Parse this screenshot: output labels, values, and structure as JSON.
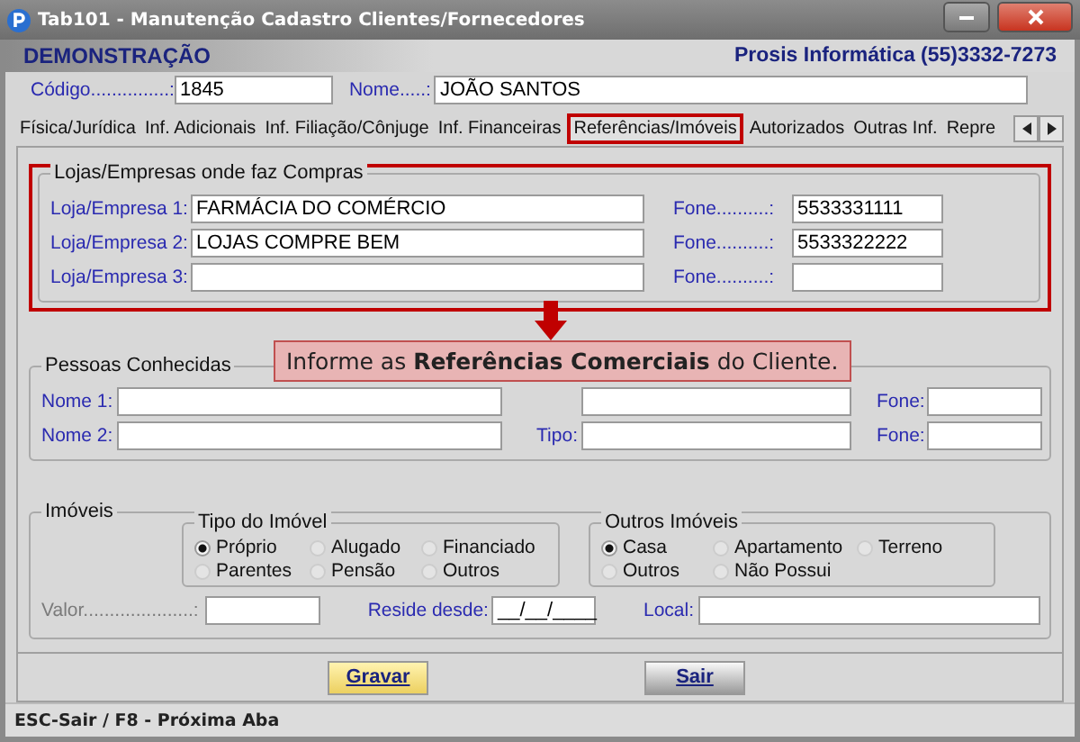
{
  "window": {
    "title": "Tab101 - Manutenção Cadastro Clientes/Fornecedores"
  },
  "header": {
    "company": "DEMONSTRAÇÃO",
    "vendor": "Prosis Informática (55)3332-7273"
  },
  "client": {
    "code_label": "Código...............:",
    "code": "1845",
    "name_label": "Nome.....:",
    "name": "JOÃO SANTOS"
  },
  "tabs": [
    {
      "label": "Física/Jurídica",
      "selected": false
    },
    {
      "label": "Inf. Adicionais",
      "selected": false
    },
    {
      "label": "Inf. Filiação/Cônjuge",
      "selected": false
    },
    {
      "label": "Inf. Financeiras",
      "selected": false
    },
    {
      "label": "Referências/Imóveis",
      "selected": true
    },
    {
      "label": "Autorizados",
      "selected": false
    },
    {
      "label": "Outras Inf.",
      "selected": false
    },
    {
      "label": "Repre",
      "selected": false
    }
  ],
  "stores": {
    "title": "Lojas/Empresas onde faz Compras",
    "rows": [
      {
        "label": "Loja/Empresa 1:",
        "value": "FARMÁCIA DO COMÉRCIO",
        "phone_label": "Fone..........:",
        "phone": "5533331111"
      },
      {
        "label": "Loja/Empresa 2:",
        "value": "LOJAS COMPRE BEM",
        "phone_label": "Fone..........:",
        "phone": "5533322222"
      },
      {
        "label": "Loja/Empresa 3:",
        "phone_label": "Fone..........:"
      }
    ]
  },
  "tooltip": {
    "text": "Informe as **Referências Comerciais** do Cliente."
  },
  "people": {
    "title": "Pessoas Conhecidas",
    "rows": [
      {
        "label": "Nome 1:",
        "phone_label": "Fone:"
      },
      {
        "label": "Nome 2:",
        "type_label": "Tipo:",
        "phone_label": "Fone:"
      }
    ]
  },
  "property": {
    "title": "Imóveis",
    "type_group": {
      "title": "Tipo do Imóvel",
      "options": [
        {
          "label": "Próprio",
          "selected": true
        },
        {
          "label": "Alugado",
          "selected": false
        },
        {
          "label": "Financiado",
          "selected": false
        },
        {
          "label": "Parentes",
          "selected": false
        },
        {
          "label": "Pensão",
          "selected": false
        },
        {
          "label": "Outros",
          "selected": false
        }
      ]
    },
    "other_group": {
      "title": "Outros Imóveis",
      "options": [
        {
          "label": "Casa",
          "selected": true
        },
        {
          "label": "Apartamento",
          "selected": false
        },
        {
          "label": "Terreno",
          "selected": false
        },
        {
          "label": "Outros",
          "selected": false
        },
        {
          "label": "Não Possui",
          "selected": false
        }
      ]
    },
    "value_label": "Valor.....................:",
    "value_disabled": true,
    "since_label": "Reside desde:",
    "since": "__/__/____",
    "local_label": "Local:"
  },
  "buttons": [
    {
      "label": "Gravar",
      "kind": "primary"
    },
    {
      "label": "Sair",
      "kind": "secondary"
    }
  ],
  "status_bar": "ESC-Sair / F8 - Próxima Aba"
}
